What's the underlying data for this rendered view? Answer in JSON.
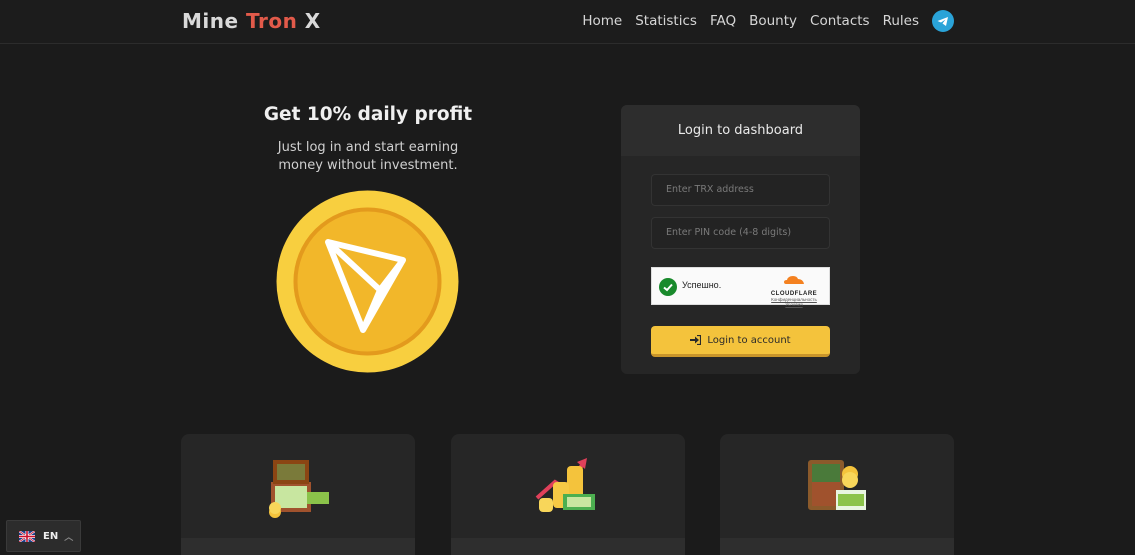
{
  "header": {
    "logo": {
      "part1": "Mine",
      "part2": "Tron",
      "part3": "X"
    },
    "nav": [
      "Home",
      "Statistics",
      "FAQ",
      "Bounty",
      "Contacts",
      "Rules"
    ],
    "telegram_icon": "telegram-icon"
  },
  "hero": {
    "title": "Get 10% daily profit",
    "subtitle": "Just log in and start earning money without investment."
  },
  "login": {
    "title": "Login to dashboard",
    "address_placeholder": "Enter TRX address",
    "pin_placeholder": "Enter PIN code (4-8 digits)",
    "captcha_status": "Успешно.",
    "captcha_brand": "CLOUDFLARE",
    "captcha_privacy": "Конфиденциальность",
    "captcha_terms": "Условия",
    "button_label": "Login to account"
  },
  "language": {
    "code": "EN"
  },
  "colors": {
    "accent": "#f4c33c",
    "logo_red": "#e25a4a",
    "background": "#1b1b1b",
    "card": "#262626",
    "telegram": "#2aa3d8"
  }
}
